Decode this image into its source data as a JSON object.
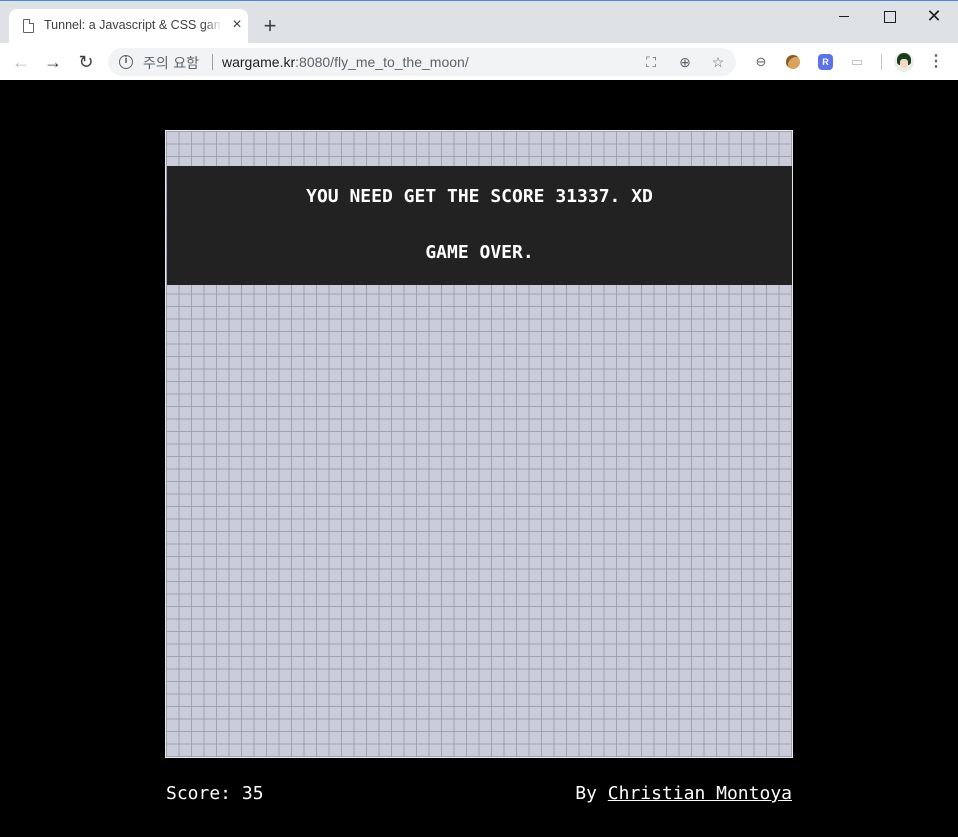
{
  "browser": {
    "tab": {
      "title": "Tunnel: a Javascript & CSS game",
      "close": "×"
    },
    "new_tab": "+",
    "window": {
      "minimize": "",
      "maximize": "",
      "close": "✕"
    },
    "nav": {
      "back": "←",
      "forward": "→",
      "reload": "↻"
    },
    "omnibox": {
      "info": "i",
      "security_label": "주의 요함",
      "url_host": "wargame.kr",
      "url_rest": ":8080/fly_me_to_the_moon/"
    },
    "omni_icons": {
      "translate": "⛶",
      "zoom": "⊕",
      "star": "☆"
    },
    "extensions": {
      "block": "⊖",
      "cast": "▭"
    },
    "menu": "⋮"
  },
  "game": {
    "message": "YOU NEED GET THE SCORE 31337. XD",
    "status": "GAME OVER."
  },
  "footer": {
    "score_label": "Score: 35",
    "credit_prefix": "By ",
    "credit_name": "Christian Montoya"
  },
  "colors": {
    "page_background": "#000000",
    "board_background": "#cacdd9",
    "banner_background": "#222222",
    "text": "#ffffff"
  }
}
